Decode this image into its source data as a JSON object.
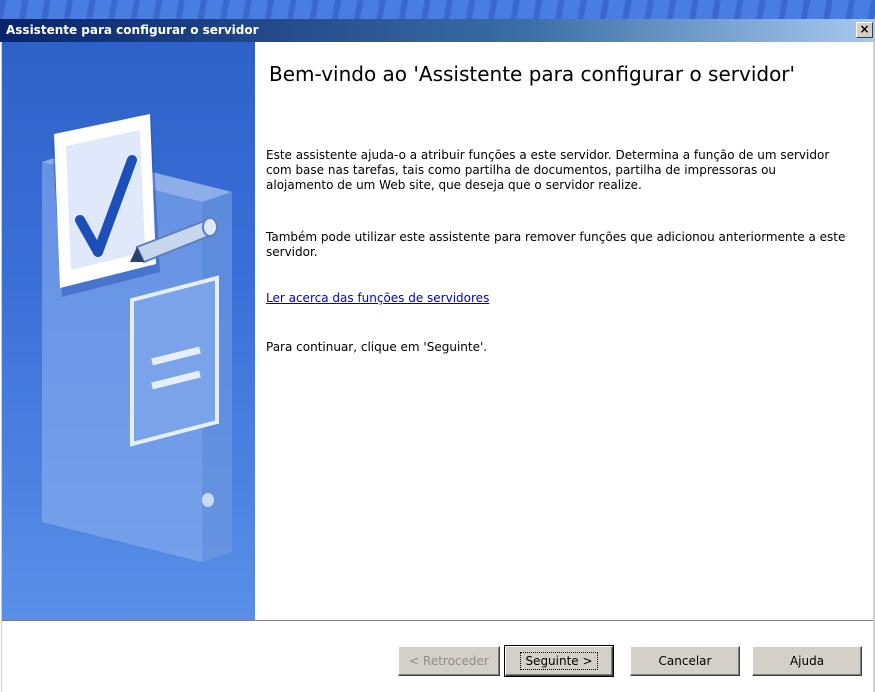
{
  "window": {
    "title": "Assistente para configurar o servidor",
    "close_symbol": "×"
  },
  "content": {
    "heading": "Bem-vindo ao 'Assistente para configurar o servidor'",
    "paragraph1": "Este assistente ajuda-o a atribuir funções a este servidor. Determina a função de um servidor com base nas tarefas, tais como partilha de documentos, partilha de impressoras ou alojamento de um Web site, que deseja que o servidor realize.",
    "paragraph2": "Também pode utilizar este assistente para remover funções que adicionou anteriormente a este servidor.",
    "link": "Ler acerca das funções de servidores",
    "paragraph3": "Para continuar, clique em 'Seguinte'."
  },
  "buttons": {
    "back": "< Retroceder",
    "next": "Seguinte >",
    "cancel": "Cancelar",
    "help": "Ajuda"
  },
  "icons": {
    "wizard_graphic": "server-checklist-icon",
    "close": "close-icon"
  },
  "colors": {
    "titlebar": "#0a246a",
    "side_panel": "#3b6fd8",
    "link": "#0000cc"
  }
}
